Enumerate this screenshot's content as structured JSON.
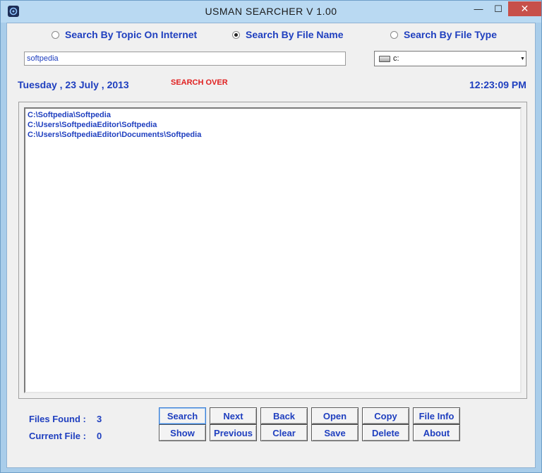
{
  "window": {
    "title": "USMAN  SEARCHER   V 1.00",
    "minimize_glyph": "—",
    "maximize_glyph": "☐",
    "close_glyph": "✕"
  },
  "search_modes": [
    {
      "label": "Search By Topic On Internet",
      "selected": false
    },
    {
      "label": "Search By File Name",
      "selected": true
    },
    {
      "label": "Search By File Type",
      "selected": false
    }
  ],
  "search": {
    "value": "softpedia"
  },
  "drive": {
    "value": "c:",
    "icon": "hard-drive-icon"
  },
  "date": "Tuesday , 23 July , 2013",
  "status": "SEARCH OVER",
  "time": "12:23:09 PM",
  "results": [
    "C:\\Softpedia\\Softpedia",
    "C:\\Users\\SoftpediaEditor\\Softpedia",
    "C:\\Users\\SoftpediaEditor\\Documents\\Softpedia"
  ],
  "info": {
    "files_found_label": "Files Found :",
    "files_found_value": "3",
    "current_file_label": "Current File :",
    "current_file_value": "0"
  },
  "buttons": {
    "search": "Search",
    "next": "Next",
    "back": "Back",
    "open": "Open",
    "copy": "Copy",
    "file_info": "File Info",
    "show": "Show",
    "previous": "Previous",
    "clear": "Clear",
    "save": "Save",
    "delete": "Delete",
    "about": "About"
  },
  "colors": {
    "label_blue": "#1f3fbf",
    "status_red": "#e02020",
    "title_bar": "#b9d9f2",
    "close_red": "#c7504a"
  }
}
